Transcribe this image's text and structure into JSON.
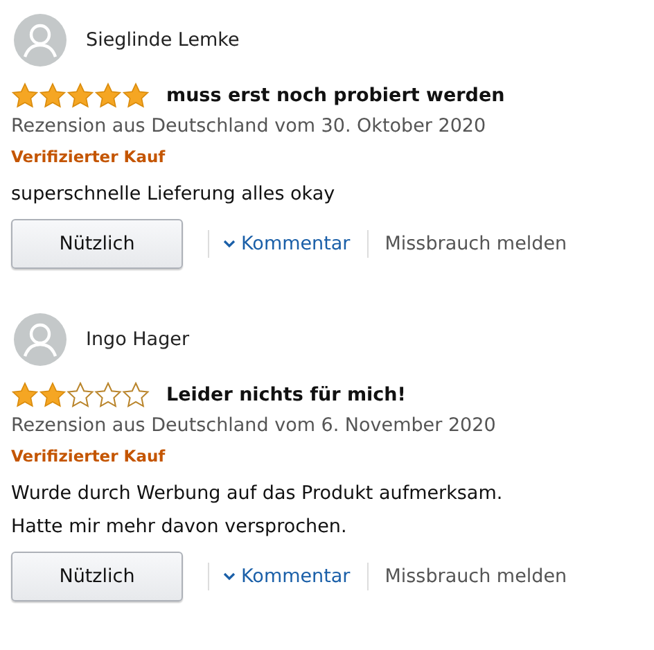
{
  "reviews": [
    {
      "author": "Sieglinde Lemke",
      "stars": 5,
      "title": "muss erst noch probiert werden",
      "date_line": "Rezension aus Deutschland vom 30. Oktober 2020",
      "badge": "Verifizierter Kauf",
      "body_lines": [
        "superschnelle Lieferung alles okay"
      ],
      "helpful_button": "Nützlich",
      "comment_link": "Kommentar",
      "report_link": "Missbrauch melden"
    },
    {
      "author": "Ingo Hager",
      "stars": 2,
      "title": "Leider nichts für mich!",
      "date_line": "Rezension aus Deutschland vom 6. November 2020",
      "badge": "Verifizierter Kauf",
      "body_lines": [
        "Wurde durch Werbung auf das Produkt aufmerksam.",
        "Hatte mir mehr davon versprochen."
      ],
      "helpful_button": "Nützlich",
      "comment_link": "Kommentar",
      "report_link": "Missbrauch melden"
    }
  ]
}
